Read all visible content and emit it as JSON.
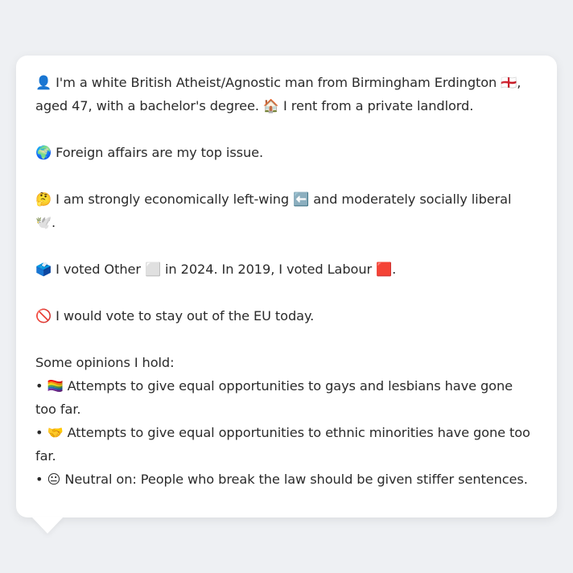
{
  "profile": {
    "intro_line1": "👤 I'm a white British Atheist/Agnostic man from Birmingham Erdington 🏴󠁧󠁢󠁥󠁮󠁧󠁿,",
    "intro_line2": "aged 47, with a bachelor's degree. 🏠 I rent from a private landlord.",
    "top_issue": "🌍 Foreign affairs are my top issue.",
    "ideology_line1": "🤔 I am strongly economically left-wing ⬅️ and moderately socially liberal",
    "ideology_line2": "🕊️.",
    "votes": "🗳️ I voted Other ⬜ in 2024. In 2019, I voted Labour 🟥.",
    "eu": "🚫 I would vote to stay out of the EU today.",
    "opinions_header": "Some opinions I hold:",
    "opinions": [
      {
        "line1": "• 🏳️‍🌈 Attempts to give equal opportunities to gays and lesbians have gone",
        "line2": "too far."
      },
      {
        "line1": "• 🤝 Attempts to give equal opportunities to ethnic minorities have gone too",
        "line2": "far."
      },
      {
        "line1": "• 😐 Neutral on: People who break the law should be given stiffer sentences."
      }
    ]
  },
  "colors": {
    "background": "#eef0f3",
    "bubble": "#ffffff",
    "text": "#2b2b2b"
  }
}
